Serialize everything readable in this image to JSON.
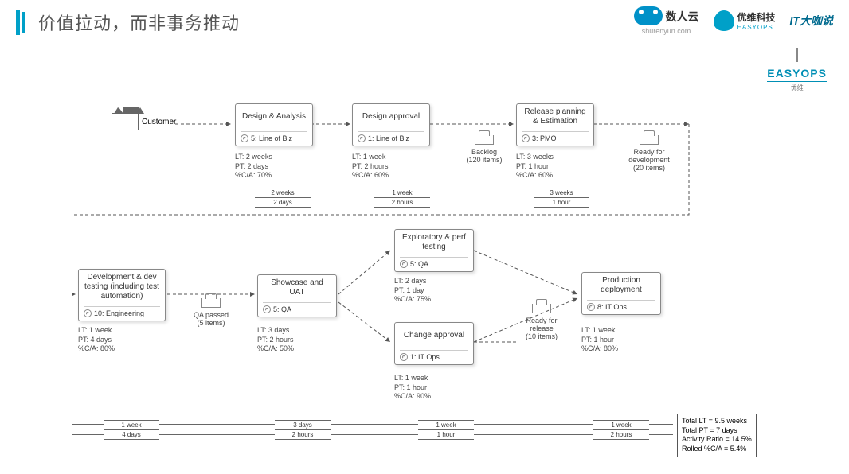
{
  "header": {
    "title": "价值拉动，而非事务推动"
  },
  "logos": {
    "shurenyun": "数人云",
    "shurenyun_sub": "shurenyun.com",
    "easyops": "优维科技",
    "easyops_sub": "EASYOPS",
    "itdakashuo": "IT大咖说",
    "sublogo_brand": "EASYOPS",
    "sublogo_sub": "优维"
  },
  "customer": "Customer",
  "boxes": {
    "design": {
      "title": "Design & Analysis",
      "role": "5: Line of Biz",
      "lt": "LT: 2 weeks",
      "pt": "PT: 2 days",
      "ca": "%C/A: 70%"
    },
    "approval": {
      "title": "Design approval",
      "role": "1: Line of Biz",
      "lt": "LT: 1 week",
      "pt": "PT: 2 hours",
      "ca": "%C/A: 60%"
    },
    "release": {
      "title": "Release planning & Estimation",
      "role": "3: PMO",
      "lt": "LT: 3 weeks",
      "pt": "PT: 1 hour",
      "ca": "%C/A: 60%"
    },
    "dev": {
      "title": "Development & dev testing (including test automation)",
      "role": "10: Engineering",
      "lt": "LT: 1 week",
      "pt": "PT: 4 days",
      "ca": "%C/A: 80%"
    },
    "uat": {
      "title": "Showcase and UAT",
      "role": "5: QA",
      "lt": "LT: 3 days",
      "pt": "PT: 2 hours",
      "ca": "%C/A: 50%"
    },
    "perf": {
      "title": "Exploratory & perf testing",
      "role": "5: QA",
      "lt": "LT: 2 days",
      "pt": "PT: 1 day",
      "ca": "%C/A: 75%"
    },
    "change": {
      "title": "Change approval",
      "role": "1: IT Ops",
      "lt": "LT: 1 week",
      "pt": "PT: 1 hour",
      "ca": "%C/A: 90%"
    },
    "prod": {
      "title": "Production deployment",
      "role": "8: IT Ops",
      "lt": "LT: 1 week",
      "pt": "PT: 1 hour",
      "ca": "%C/A: 80%"
    }
  },
  "queues": {
    "backlog": {
      "label": "Backlog",
      "count": "(120 items)"
    },
    "readydev": {
      "label": "Ready for development",
      "count": "(20 items)"
    },
    "qapassed": {
      "label": "QA passed",
      "count": "(5 items)"
    },
    "readyrel": {
      "label": "Ready for release",
      "count": "(10 items)"
    }
  },
  "ladders_top": [
    {
      "top": "2 weeks",
      "bot": "2 days"
    },
    {
      "top": "1 week",
      "bot": "2 hours"
    },
    {
      "top": "3 weeks",
      "bot": "1 hour"
    }
  ],
  "ladders_bot": [
    {
      "top": "1 week",
      "bot": "4 days"
    },
    {
      "top": "3 days",
      "bot": "2 hours"
    },
    {
      "top": "1 week",
      "bot": "1 hour"
    },
    {
      "top": "1 week",
      "bot": "2 hours"
    }
  ],
  "summary": {
    "lt": "Total LT = 9.5 weeks",
    "pt": "Total PT = 7 days",
    "ar": "Activity Ratio = 14.5%",
    "rc": "Rolled %C/A = 5.4%"
  }
}
